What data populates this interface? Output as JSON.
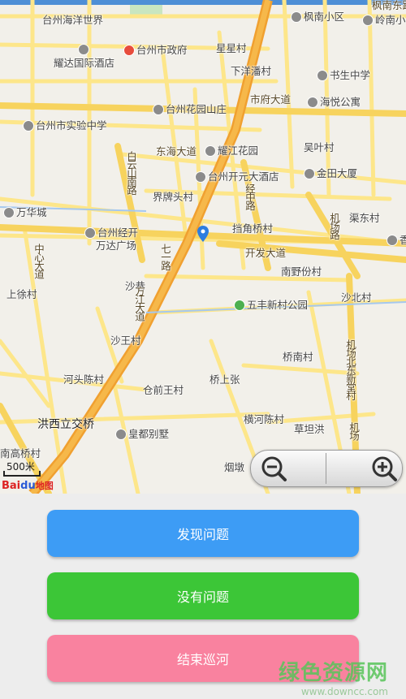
{
  "map": {
    "labels": {
      "haiyang": "台州海洋世界",
      "fengnan_xq": "枫南小区",
      "lingnan": "岭南小",
      "fengnan_dong": "枫南东路",
      "yaoda": "耀达国际酒店",
      "gov": "台州市政府",
      "xingxing": "星星村",
      "xiayang": "下洋潘村",
      "shusheng": "书生中学",
      "shifu": "市府大道",
      "haiyue": "海悦公寓",
      "huayuan": "台州花园山庄",
      "shiyan": "台州市实验中学",
      "wuye": "吴叶村",
      "donghai": "东海大道",
      "yaojiang": "耀江花园",
      "kaiyuan": "台州开元大酒店",
      "jintian": "金田大厦",
      "baiyun": "白云山南路",
      "jiepai": "界牌头村",
      "jingzhong": "经中路",
      "wanhua": "万华城",
      "qudong": "渠东村",
      "dangjiao": "挡角桥村",
      "jichang": "机场路",
      "xiang": "香",
      "jingkai": "台州经开",
      "wanda": "万达广场",
      "zhongxin": "中心大道",
      "kaifa": "开发大道",
      "nanye": "南野份村",
      "shangxu": "上徐村",
      "qiyi": "七一路",
      "shaxiang": "沙巷",
      "wufeng": "五丰新村公园",
      "shabei": "沙北村",
      "fangjiang": "方江大道",
      "shawang": "沙王村",
      "jichang_bei": "机场北东新堂村",
      "qiaonan": "桥南村",
      "hetou": "河头陈村",
      "qiaoshang": "桥上张",
      "cangqian": "仓前王村",
      "hongxi": "洪西立交桥",
      "henghe": "横河陈村",
      "caotan": "草坦洪",
      "jichang2": "机场",
      "huangdu": "皇都别墅",
      "nangao": "南高桥村",
      "yandun": "烟墩"
    },
    "scale_label": "500米",
    "logo_main": "Bai",
    "logo_du": "du",
    "logo_sub": "地图"
  },
  "buttons": {
    "find": "发现问题",
    "none": "没有问题",
    "end": "结束巡河"
  },
  "watermark": {
    "title": "绿色资源网",
    "url": "www.downcc.com"
  },
  "colors": {
    "find": "#3d9cf5",
    "none": "#3cc637",
    "end": "#f9829f",
    "arterial": "#f5a623",
    "road": "#fde68a"
  }
}
